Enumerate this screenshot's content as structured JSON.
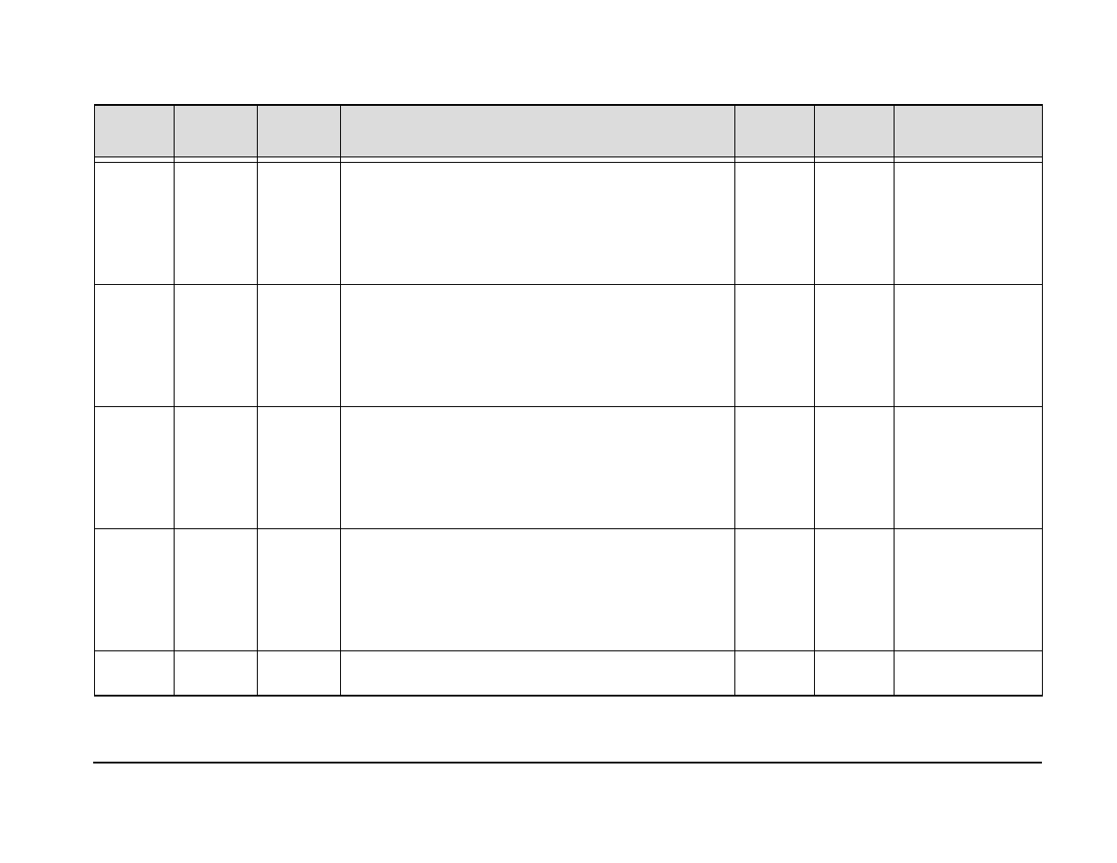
{
  "table": {
    "headers": [
      "",
      "",
      "",
      "",
      "",
      "",
      ""
    ],
    "rows": [
      [
        "",
        "",
        "",
        "",
        "",
        "",
        ""
      ],
      [
        "",
        "",
        "",
        "",
        "",
        "",
        ""
      ],
      [
        "",
        "",
        "",
        "",
        "",
        "",
        ""
      ],
      [
        "",
        "",
        "",
        "",
        "",
        "",
        ""
      ],
      [
        "",
        "",
        "",
        "",
        "",
        "",
        ""
      ]
    ]
  }
}
